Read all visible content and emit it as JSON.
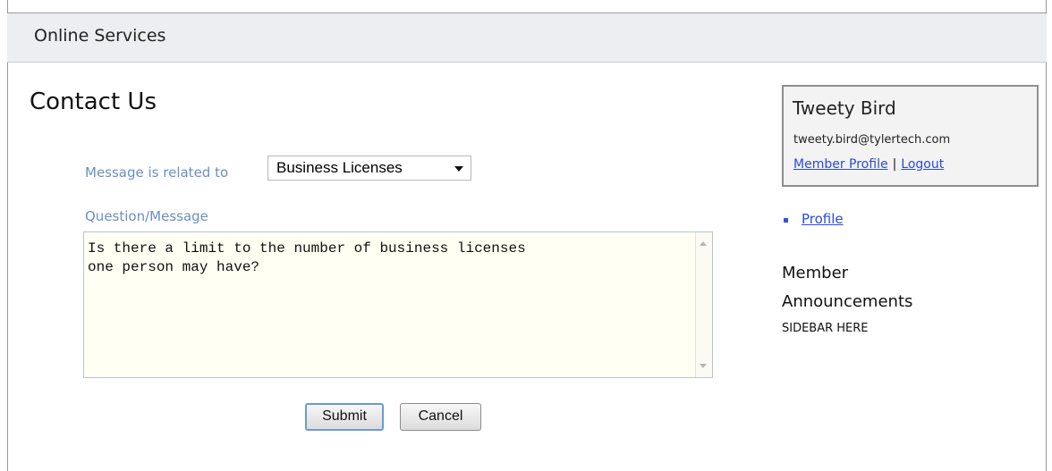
{
  "header": {
    "title": "Online Services"
  },
  "page": {
    "title": "Contact Us"
  },
  "form": {
    "related_label": "Message is related to",
    "related_value": "Business Licenses",
    "message_label": "Question/Message",
    "message_value": "Is there a limit to the number of business licenses\none person may have?",
    "submit_label": "Submit",
    "cancel_label": "Cancel"
  },
  "member": {
    "name": "Tweety Bird",
    "email": "tweety.bird@tylertech.com",
    "profile_link": "Member Profile",
    "separator": "|",
    "logout_link": "Logout"
  },
  "sidebar": {
    "items": [
      {
        "label": "Profile"
      }
    ],
    "announcements_title": "Member Announcements",
    "placeholder_text": "SIDEBAR HERE"
  },
  "colors": {
    "label_blue": "#6b8fc4",
    "link_blue": "#2a4bd8",
    "header_bg": "#eceef1",
    "textarea_bg": "#fffff3"
  },
  "icons": {
    "select_arrow": "chevron-down-icon",
    "bullet": "square-bullet-icon"
  }
}
